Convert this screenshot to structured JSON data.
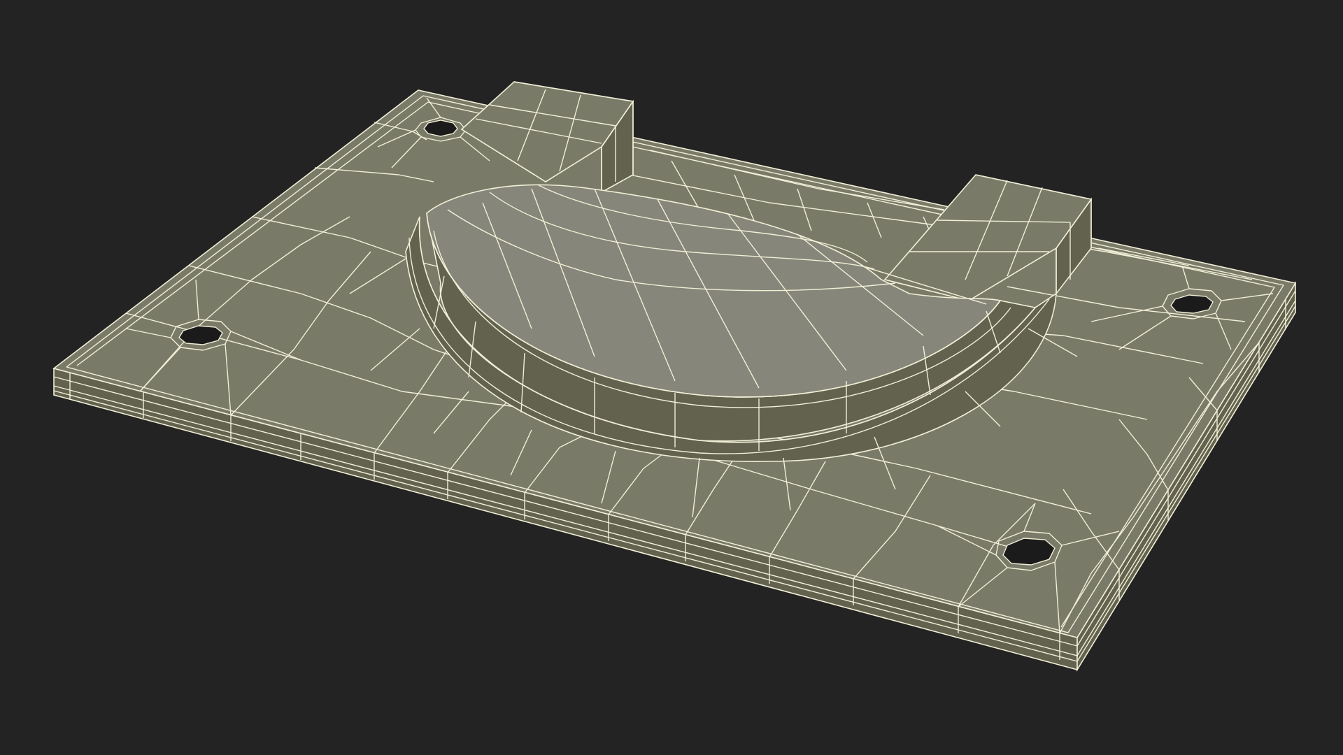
{
  "scene": {
    "subject": "wireframe-mounting-plate",
    "background_color": "#232323",
    "surface_color": "#7a7a69",
    "surface_dark_color": "#62624f",
    "surface_light_color": "#86867a",
    "wire_color": "#f1efd6",
    "hole_color": "#1b1b1b",
    "mounting_hole_count": 4,
    "mounting_hole_shape": "octagon",
    "tab_count": 2
  }
}
